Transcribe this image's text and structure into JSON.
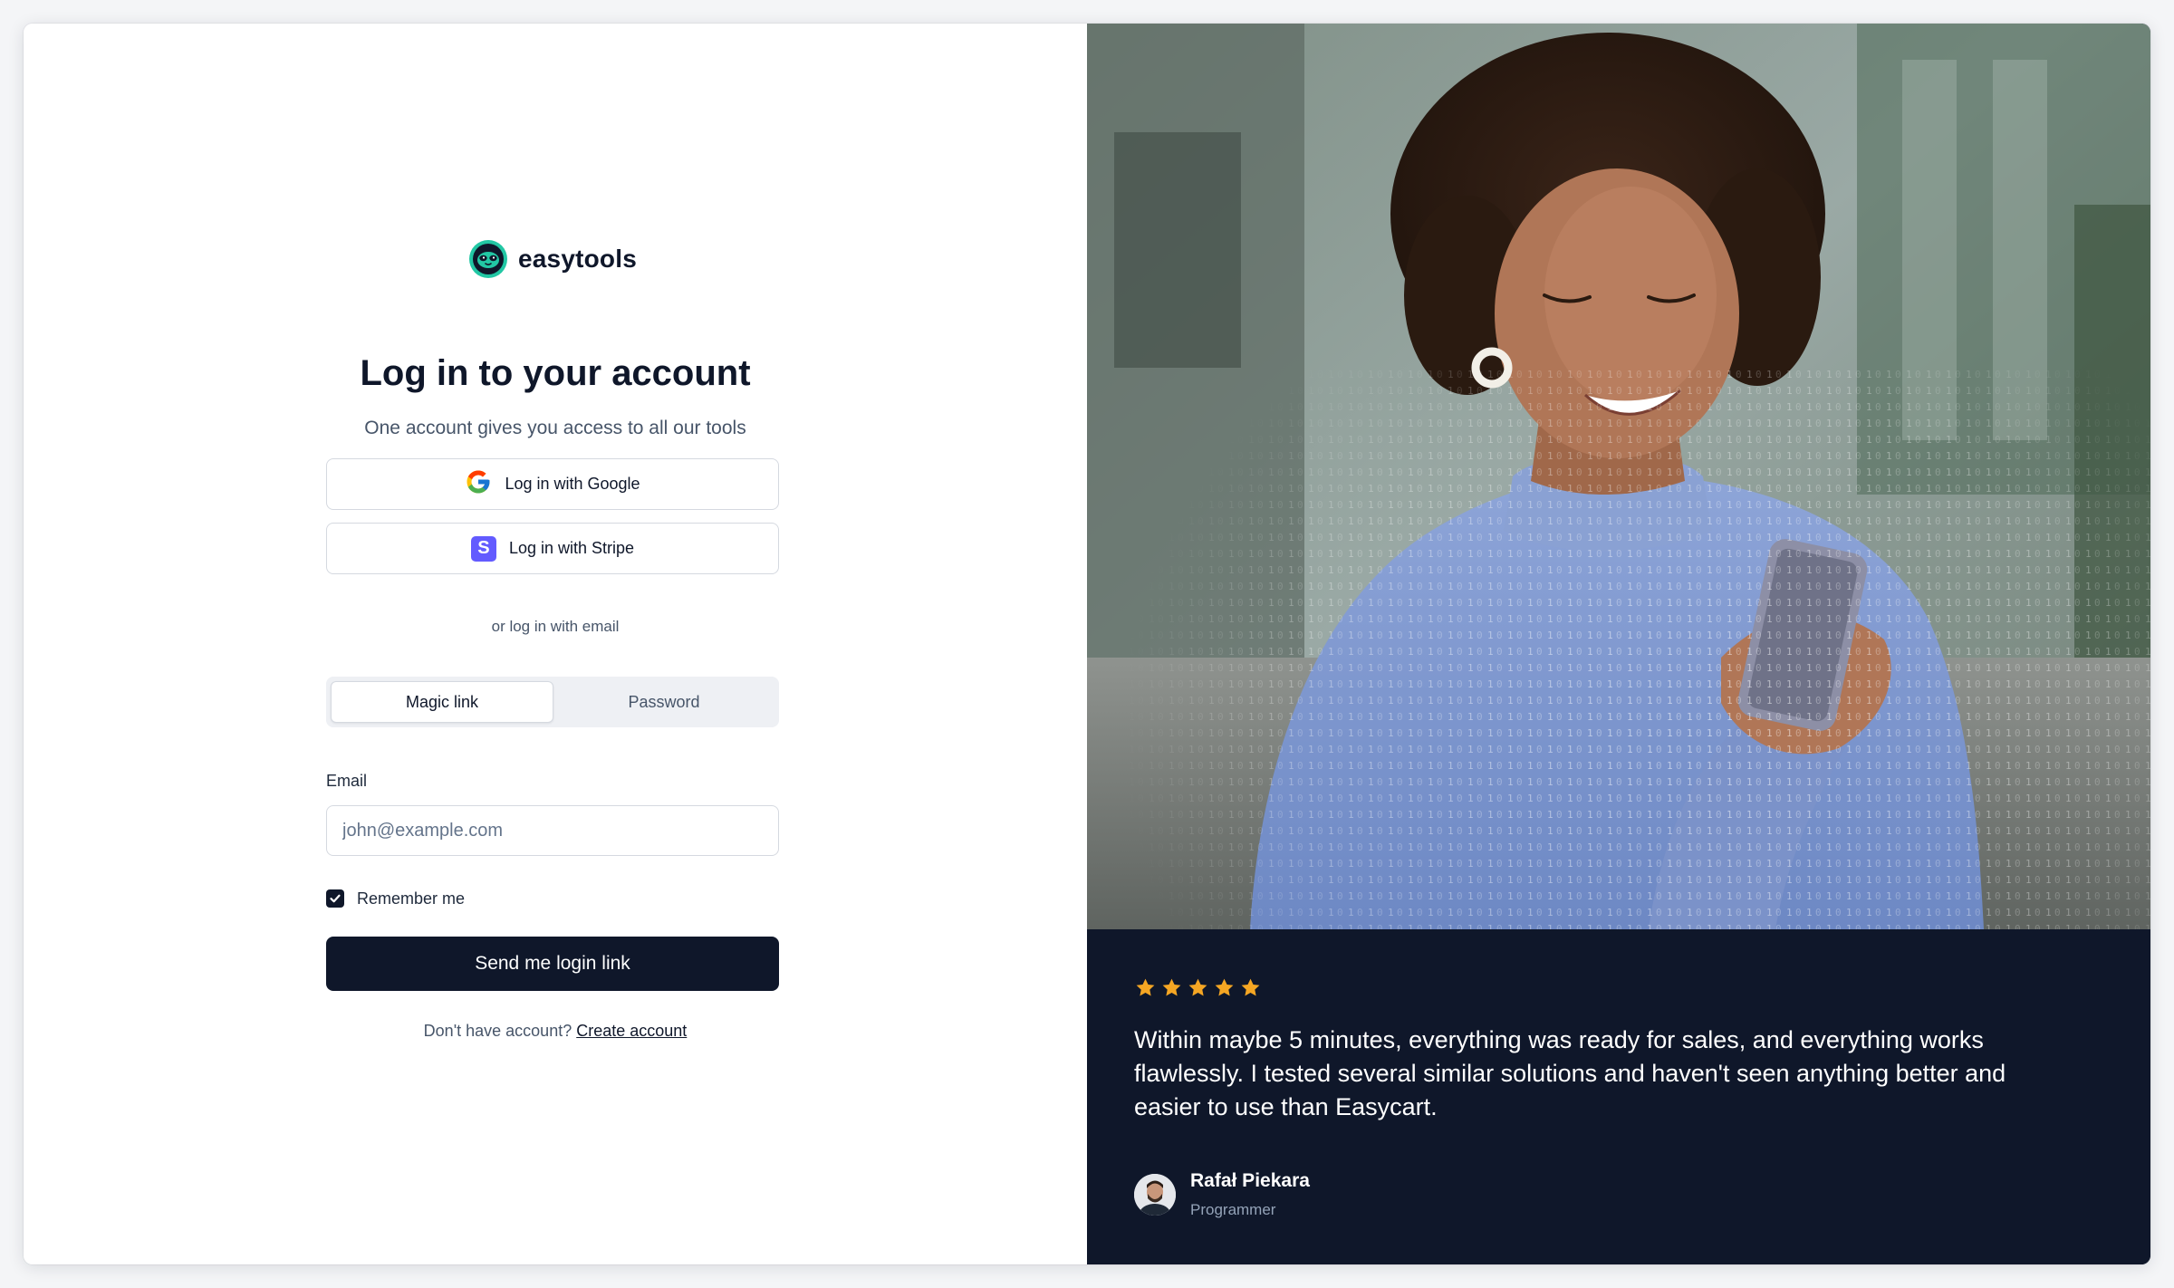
{
  "brand": {
    "name": "easytools"
  },
  "login": {
    "title": "Log in to your account",
    "subtitle": "One account gives you access to all our tools",
    "google_label": "Log in with Google",
    "stripe_label": "Log in with Stripe",
    "stripe_glyph": "S",
    "divider": "or log in with email",
    "tabs": [
      {
        "label": "Magic link",
        "active": true
      },
      {
        "label": "Password",
        "active": false
      }
    ],
    "email_label": "Email",
    "email_value": "",
    "email_placeholder": "john@example.com",
    "remember_label": "Remember me",
    "remember_checked": true,
    "submit_label": "Send me login link",
    "signup_prompt": "Don't have account?",
    "signup_link": "Create account"
  },
  "testimonial": {
    "rating": 5,
    "quote": "Within maybe 5 minutes, everything was ready for sales, and everything works flawlessly. I tested several similar solutions and haven't seen anything better and easier to use than Easycart.",
    "author_name": "Rafał Piekara",
    "author_role": "Programmer"
  },
  "colors": {
    "primary": "#0f172a",
    "brand_green": "#22c7a4",
    "stripe_purple": "#635bff",
    "star": "#f5a623"
  }
}
